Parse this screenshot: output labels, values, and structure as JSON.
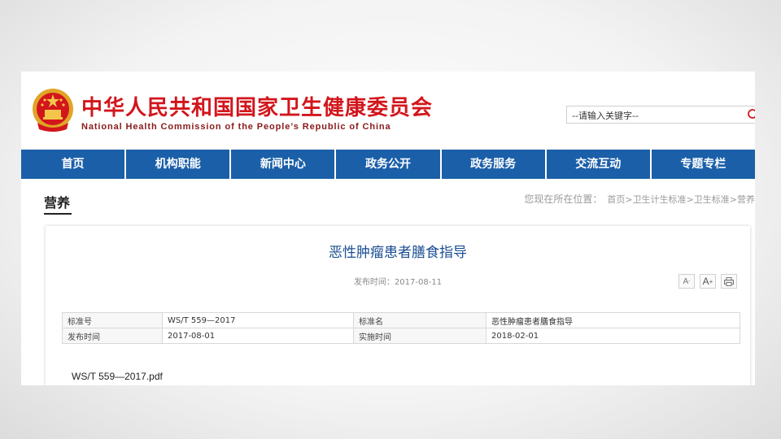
{
  "header": {
    "title": "中华人民共和国国家卫生健康委员会",
    "subtitle": "National Health Commission of the People’s Republic of China",
    "emblem_icon": "national-emblem-icon",
    "brand_color": "#d2161c"
  },
  "search": {
    "placeholder": "--请输入关键字--",
    "icon": "search-icon"
  },
  "nav": {
    "color": "#1b5fa8",
    "items": [
      {
        "label": "首页"
      },
      {
        "label": "机构职能"
      },
      {
        "label": "新闻中心"
      },
      {
        "label": "政务公开"
      },
      {
        "label": "政务服务"
      },
      {
        "label": "交流互动"
      },
      {
        "label": "专题专栏"
      }
    ]
  },
  "section": {
    "title": "营养"
  },
  "breadcrumb": {
    "prefix": "您现在所在位置：",
    "items": [
      "首页",
      "卫生计生标准",
      "卫生标准",
      "营养"
    ],
    "separator": ">"
  },
  "article": {
    "title": "恶性肿瘤患者膳食指导",
    "publish_label": "发布时间：",
    "publish_date": "2017-08-11",
    "tools": [
      "font-decrease-icon",
      "font-increase-icon",
      "print-icon"
    ],
    "meta": {
      "row1": {
        "label_a": "标准号",
        "value_a": "WS/T 559—2017",
        "label_b": "标准名",
        "value_b": "恶性肿瘤患者膳食指导"
      },
      "row2": {
        "label_a": "发布时间",
        "value_a": "2017-08-01",
        "label_b": "实施时间",
        "value_b": "2018-02-01"
      }
    },
    "attachment": "WS/T 559—2017.pdf"
  }
}
